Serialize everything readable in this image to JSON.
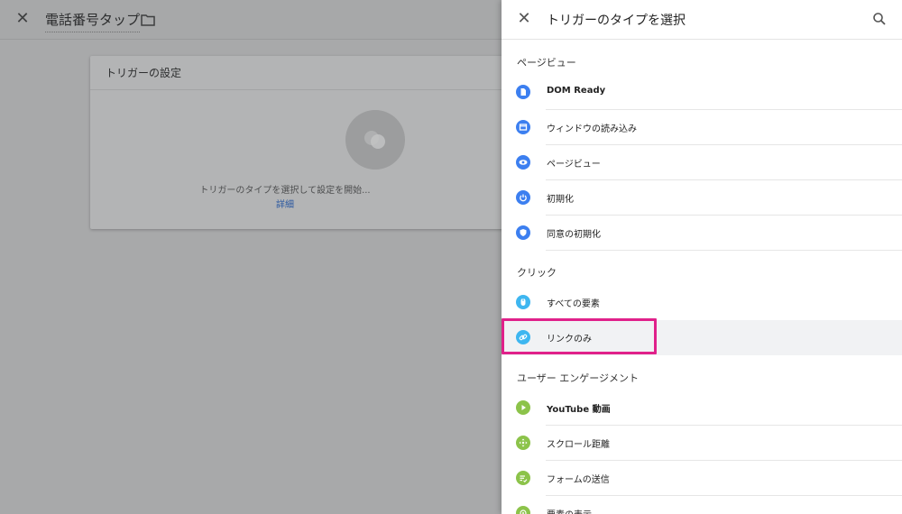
{
  "background": {
    "tag_title": "電話番号タップ",
    "card": {
      "title": "トリガーの設定",
      "message": "トリガーのタイプを選択して設定を開始...",
      "link": "詳細"
    }
  },
  "panel": {
    "title": "トリガーのタイプを選択",
    "sections": [
      {
        "heading": "ページビュー",
        "items": [
          {
            "label": "DOM Ready",
            "icon": "document-icon",
            "color": "#3c7ff0"
          },
          {
            "label": "ウィンドウの読み込み",
            "icon": "window-icon",
            "color": "#3c7ff0"
          },
          {
            "label": "ページビュー",
            "icon": "eye-icon",
            "color": "#3c7ff0"
          },
          {
            "label": "初期化",
            "icon": "power-icon",
            "color": "#3c7ff0"
          },
          {
            "label": "同意の初期化",
            "icon": "shield-icon",
            "color": "#3c7ff0"
          }
        ]
      },
      {
        "heading": "クリック",
        "items": [
          {
            "label": "すべての要素",
            "icon": "mouse-icon",
            "color": "#3eb6f0"
          },
          {
            "label": "リンクのみ",
            "icon": "link-icon",
            "color": "#3eb6f0",
            "selected": true
          }
        ]
      },
      {
        "heading": "ユーザー エンゲージメント",
        "items": [
          {
            "label": "YouTube 動画",
            "icon": "play-icon",
            "color": "#8cc34a"
          },
          {
            "label": "スクロール距離",
            "icon": "move-icon",
            "color": "#8cc34a"
          },
          {
            "label": "フォームの送信",
            "icon": "form-icon",
            "color": "#8cc34a"
          },
          {
            "label": "要素の表示",
            "icon": "visibility-icon",
            "color": "#8cc34a"
          }
        ]
      }
    ]
  }
}
